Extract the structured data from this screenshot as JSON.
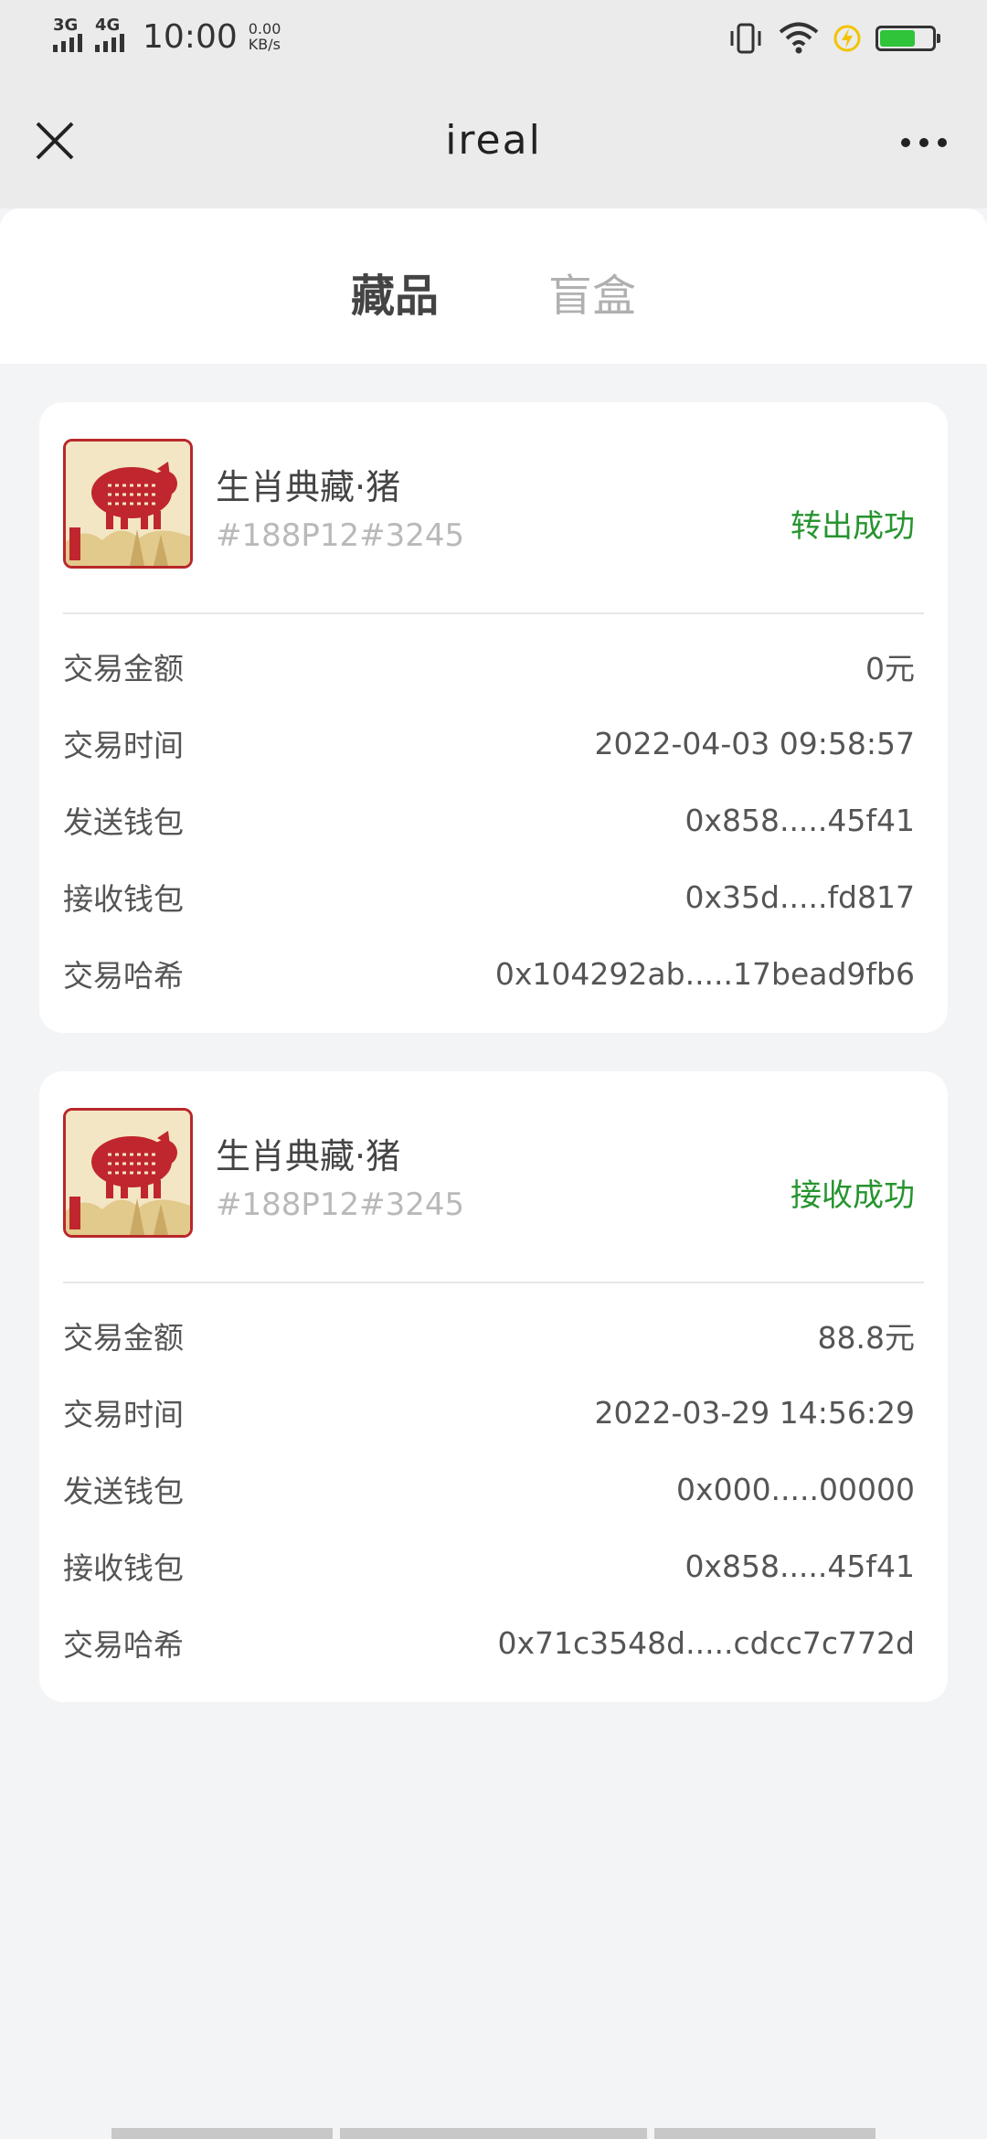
{
  "status_bar": {
    "net1": "3G",
    "net2": "4G",
    "time": "10:00",
    "speed_value": "0.00",
    "speed_unit": "KB/s",
    "battery": "63",
    "icons": [
      "vibrate-icon",
      "wifi-icon",
      "charging-icon",
      "battery-icon"
    ]
  },
  "nav": {
    "title": "ireal",
    "close_icon": "close-icon",
    "more_icon": "more-icon"
  },
  "tabs": [
    {
      "label": "藏品",
      "active": true
    },
    {
      "label": "盲盒",
      "active": false
    }
  ],
  "records": [
    {
      "name": "生肖典藏·猪",
      "id": "#188P12#3245",
      "status": "转出成功",
      "status_color": "#27942f",
      "rows": [
        {
          "label": "交易金额",
          "value": "0元"
        },
        {
          "label": "交易时间",
          "value": "2022-04-03 09:58:57"
        },
        {
          "label": "发送钱包",
          "value": "0x858.....45f41"
        },
        {
          "label": "接收钱包",
          "value": "0x35d.....fd817"
        },
        {
          "label": "交易哈希",
          "value": "0x104292ab.....17bead9fb6"
        }
      ]
    },
    {
      "name": "生肖典藏·猪",
      "id": "#188P12#3245",
      "status": "接收成功",
      "status_color": "#27942f",
      "rows": [
        {
          "label": "交易金额",
          "value": "88.8元"
        },
        {
          "label": "交易时间",
          "value": "2022-03-29 14:56:29"
        },
        {
          "label": "发送钱包",
          "value": "0x000.....00000"
        },
        {
          "label": "接收钱包",
          "value": "0x858.....45f41"
        },
        {
          "label": "交易哈希",
          "value": "0x71c3548d.....cdcc7c772d"
        }
      ]
    }
  ]
}
